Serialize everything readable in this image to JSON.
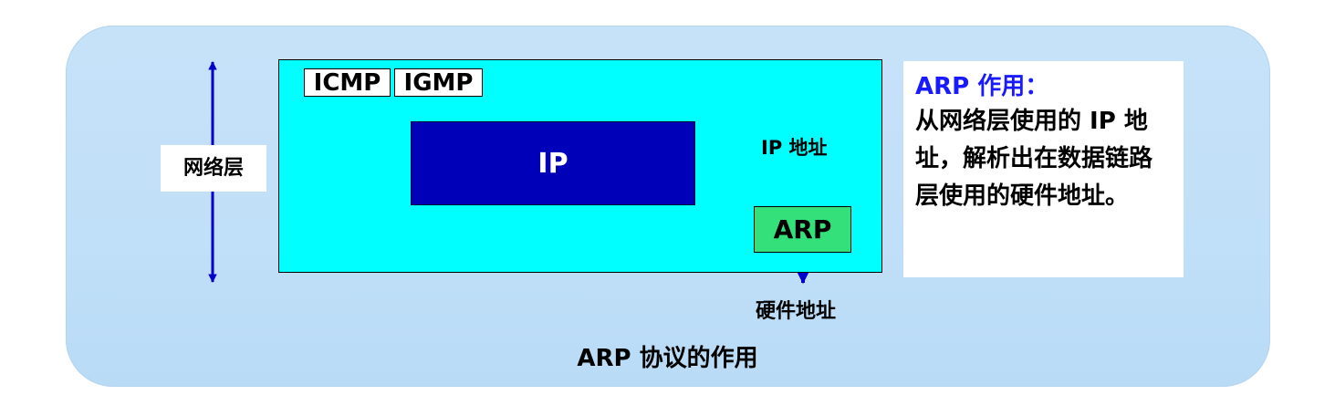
{
  "layer_label": "网络层",
  "protocols": {
    "icmp": "ICMP",
    "igmp": "IGMP"
  },
  "ip_box_label": "IP",
  "arp_box_label": "ARP",
  "ip_address_label": "IP 地址",
  "hardware_address_label": "硬件地址",
  "caption": "ARP 协议的作用",
  "side_note": {
    "title": "ARP 作用：",
    "body": "从网络层使用的 IP 地址，解析出在数据链路层使用的硬件地址。"
  },
  "colors": {
    "panel": "#c0dff8",
    "network_box": "#00ffff",
    "ip_box": "#0000b8",
    "arp_box": "#33e07a",
    "arrows": "#0000cc",
    "side_title": "#1a1aff"
  }
}
